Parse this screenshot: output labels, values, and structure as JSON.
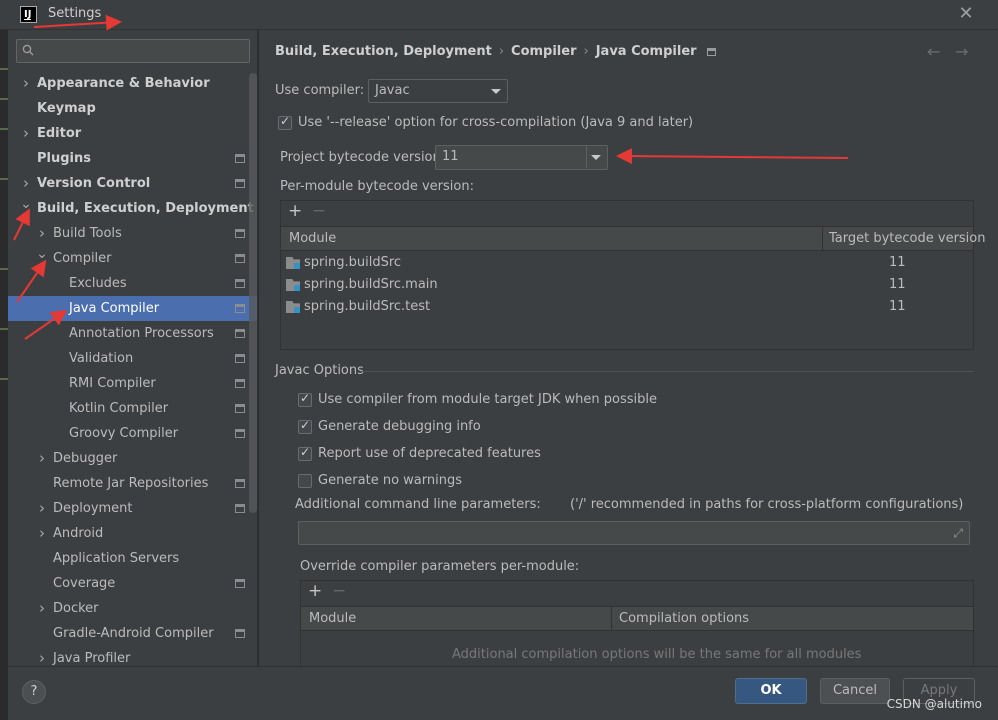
{
  "window": {
    "title": "Settings",
    "close_glyph": "✕"
  },
  "search": {
    "placeholder": ""
  },
  "tree": [
    {
      "label": "Appearance & Behavior",
      "level": 0,
      "arrow": "right",
      "bold": true,
      "project": false
    },
    {
      "label": "Keymap",
      "level": 0,
      "arrow": "none",
      "bold": true,
      "project": false
    },
    {
      "label": "Editor",
      "level": 0,
      "arrow": "right",
      "bold": true,
      "project": false
    },
    {
      "label": "Plugins",
      "level": 0,
      "arrow": "none",
      "bold": true,
      "project": true
    },
    {
      "label": "Version Control",
      "level": 0,
      "arrow": "right",
      "bold": true,
      "project": true
    },
    {
      "label": "Build, Execution, Deployment",
      "level": 0,
      "arrow": "down",
      "bold": true,
      "project": false
    },
    {
      "label": "Build Tools",
      "level": 1,
      "arrow": "right",
      "bold": false,
      "project": true
    },
    {
      "label": "Compiler",
      "level": 1,
      "arrow": "down",
      "bold": false,
      "project": true
    },
    {
      "label": "Excludes",
      "level": 2,
      "arrow": "none",
      "bold": false,
      "project": true
    },
    {
      "label": "Java Compiler",
      "level": 2,
      "arrow": "none",
      "bold": false,
      "project": true,
      "selected": true
    },
    {
      "label": "Annotation Processors",
      "level": 2,
      "arrow": "none",
      "bold": false,
      "project": true
    },
    {
      "label": "Validation",
      "level": 2,
      "arrow": "none",
      "bold": false,
      "project": true
    },
    {
      "label": "RMI Compiler",
      "level": 2,
      "arrow": "none",
      "bold": false,
      "project": true
    },
    {
      "label": "Kotlin Compiler",
      "level": 2,
      "arrow": "none",
      "bold": false,
      "project": true
    },
    {
      "label": "Groovy Compiler",
      "level": 2,
      "arrow": "none",
      "bold": false,
      "project": true
    },
    {
      "label": "Debugger",
      "level": 1,
      "arrow": "right",
      "bold": false,
      "project": false
    },
    {
      "label": "Remote Jar Repositories",
      "level": 1,
      "arrow": "none",
      "bold": false,
      "project": true
    },
    {
      "label": "Deployment",
      "level": 1,
      "arrow": "right",
      "bold": false,
      "project": true
    },
    {
      "label": "Android",
      "level": 1,
      "arrow": "right",
      "bold": false,
      "project": false
    },
    {
      "label": "Application Servers",
      "level": 1,
      "arrow": "none",
      "bold": false,
      "project": false
    },
    {
      "label": "Coverage",
      "level": 1,
      "arrow": "none",
      "bold": false,
      "project": true
    },
    {
      "label": "Docker",
      "level": 1,
      "arrow": "right",
      "bold": false,
      "project": false
    },
    {
      "label": "Gradle-Android Compiler",
      "level": 1,
      "arrow": "none",
      "bold": false,
      "project": true
    },
    {
      "label": "Java Profiler",
      "level": 1,
      "arrow": "right",
      "bold": false,
      "project": false
    }
  ],
  "breadcrumb": {
    "items": [
      "Build, Execution, Deployment",
      "Compiler",
      "Java Compiler"
    ],
    "separator": "›"
  },
  "nav": {
    "back": "←",
    "forward": "→"
  },
  "use_compiler": {
    "label": "Use compiler:",
    "value": "Javac"
  },
  "release_option": {
    "label": "Use '--release' option for cross-compilation (Java 9 and later)",
    "checked": true
  },
  "bytecode": {
    "label": "Project bytecode version:",
    "value": "11"
  },
  "per_module": {
    "label": "Per-module bytecode version:",
    "add": "+",
    "remove": "−",
    "columns": [
      "Module",
      "Target bytecode version"
    ],
    "rows": [
      {
        "module": "spring.buildSrc",
        "version": "11"
      },
      {
        "module": "spring.buildSrc.main",
        "version": "11"
      },
      {
        "module": "spring.buildSrc.test",
        "version": "11"
      }
    ]
  },
  "javac_options": {
    "title": "Javac Options",
    "checkboxes": [
      {
        "label": "Use compiler from module target JDK when possible",
        "checked": true
      },
      {
        "label": "Generate debugging info",
        "checked": true
      },
      {
        "label": "Report use of deprecated features",
        "checked": true
      },
      {
        "label": "Generate no warnings",
        "checked": false
      }
    ],
    "cmd_label": "Additional command line parameters:",
    "cmd_hint": "('/' recommended in paths for cross-platform configurations)",
    "cmd_value": "",
    "expand_glyph": "⤢"
  },
  "override": {
    "label": "Override compiler parameters per-module:",
    "add": "+",
    "remove": "−",
    "columns": [
      "Module",
      "Compilation options"
    ],
    "empty_text": "Additional compilation options will be the same for all modules"
  },
  "buttons": {
    "help": "?",
    "ok": "OK",
    "cancel": "Cancel",
    "apply": "Apply"
  },
  "watermark": "CSDN @alutimo",
  "colors": {
    "selection": "#4b6eaf",
    "ok_button": "#365880",
    "annotation": "#e53935",
    "module_icon_accent": "#3592c4"
  }
}
